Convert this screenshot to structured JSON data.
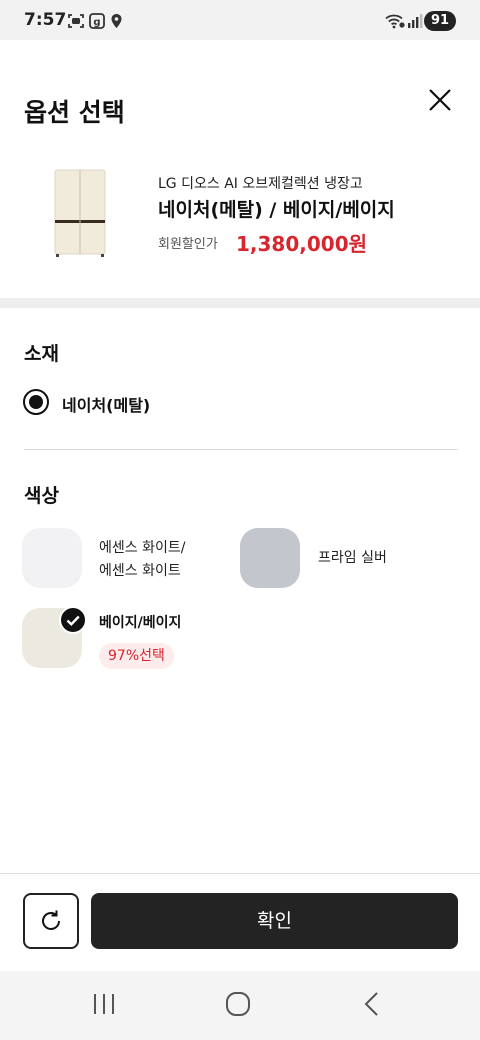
{
  "status_bar": {
    "time": "7:57",
    "battery": "91"
  },
  "sheet": {
    "title": "옵션 선택"
  },
  "product": {
    "name": "LG 디오스 AI 오브제컬렉션 냉장고",
    "option": "네이처(메탈) / 베이지/베이지",
    "price_label": "회원할인가",
    "price": "1,380,000원"
  },
  "material": {
    "title": "소재",
    "selected": "네이처(메탈)"
  },
  "color": {
    "title": "색상",
    "options": [
      {
        "label_line1": "에센스 화이트/",
        "label_line2": "에센스 화이트",
        "swatch": "#f2f2f4"
      },
      {
        "label": "프라임 실버",
        "swatch": "#c4c6cd"
      },
      {
        "label": "베이지/베이지",
        "swatch": "#ece9e1",
        "badge": "97%선택"
      }
    ]
  },
  "footer": {
    "confirm_label": "확인"
  },
  "colors": {
    "accent_red": "#d8262f",
    "button_dark": "#232323"
  }
}
